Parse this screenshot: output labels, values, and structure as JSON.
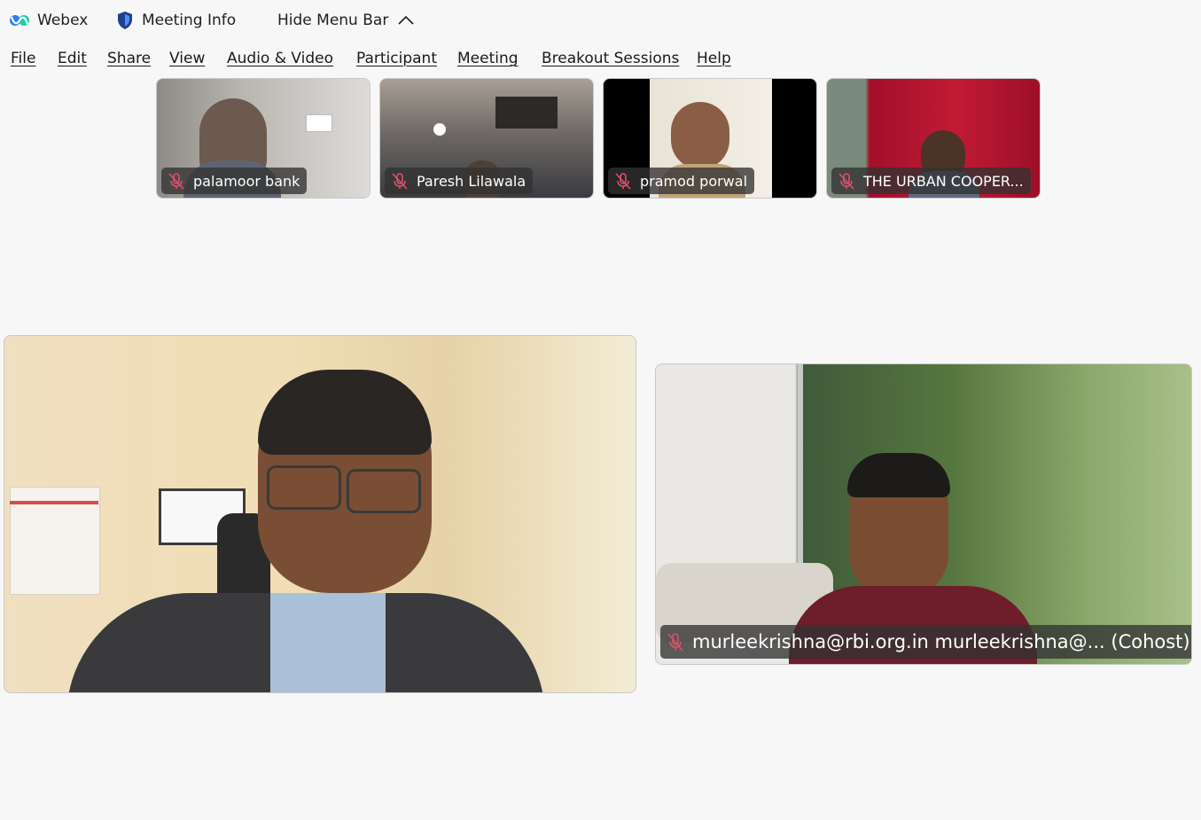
{
  "titlebar": {
    "app_name": "Webex",
    "meeting_info": "Meeting Info",
    "hide_menu_bar": "Hide Menu Bar"
  },
  "menu": [
    "File",
    "Edit",
    "Share",
    "View",
    "Audio & Video",
    "Participant",
    "Meeting",
    "Breakout Sessions",
    "Help"
  ],
  "participants": [
    {
      "name": "palamoor bank",
      "muted": true
    },
    {
      "name": "Paresh Lilawala",
      "muted": true
    },
    {
      "name": "pramod porwal",
      "muted": true
    },
    {
      "name": "THE URBAN COOPER...",
      "muted": true
    }
  ],
  "stage": {
    "cohost_label": "murleekrishna@rbi.org.in murleekrishna@... (Cohost)"
  },
  "colors": {
    "background": "#f7f7f7",
    "nametag_bg": "#323232",
    "muted_icon": "#e0506a",
    "webex_blue": "#2e7cf6"
  }
}
